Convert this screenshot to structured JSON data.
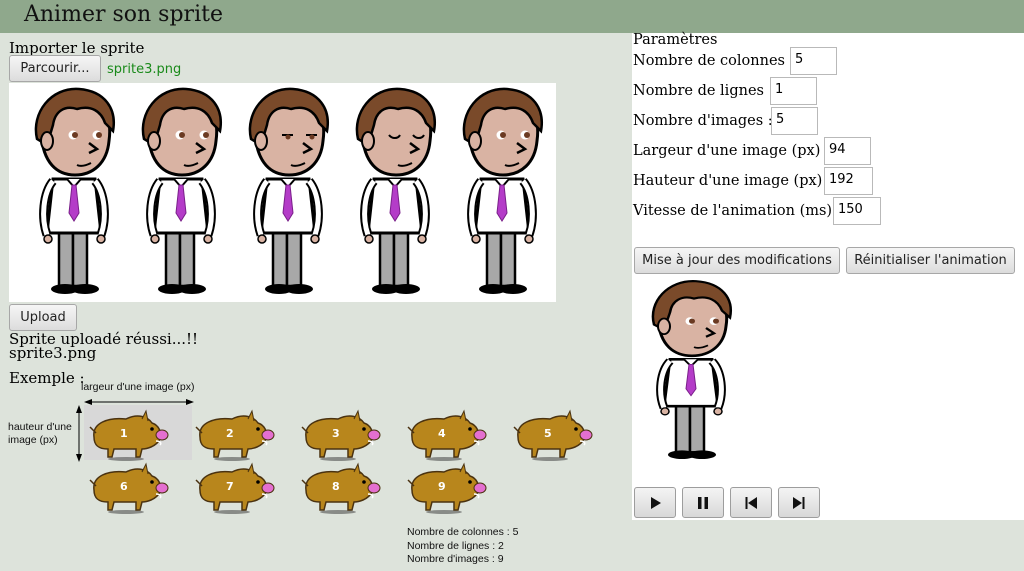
{
  "app": {
    "title": "Animer son sprite"
  },
  "import": {
    "heading": "Importer le sprite",
    "browse_label": "Parcourir...",
    "file_name": "sprite3.png",
    "upload_label": "Upload",
    "status_message": "Sprite uploadé réussi...!!",
    "uploaded_file": "sprite3.png"
  },
  "example": {
    "heading": "Exemple :",
    "width_label": "largeur d'une image (px)",
    "height_label_line1": "hauteur d'une",
    "height_label_line2": "image (px)",
    "frames": [
      "1",
      "2",
      "3",
      "4",
      "5",
      "6",
      "7",
      "8",
      "9"
    ],
    "caption_columns": "Nombre de colonnes : 5",
    "caption_rows": "Nombre de lignes : 2",
    "caption_images": "Nombre d'images : 9"
  },
  "params": {
    "heading": "Paramètres",
    "fields": [
      {
        "label": "Nombre de colonnes :",
        "value": "5"
      },
      {
        "label": "Nombre de lignes :",
        "value": "1"
      },
      {
        "label": "Nombre d'images :",
        "value": "5"
      },
      {
        "label": "Largeur d'une image (px) :",
        "value": "94"
      },
      {
        "label": "Hauteur d'une image (px) :",
        "value": "192"
      },
      {
        "label": "Vitesse de l'animation (ms) :",
        "value": "150"
      }
    ],
    "update_label": "Mise à jour des modifications",
    "reset_label": "Réinitialiser l'animation"
  },
  "controls": {
    "icons": [
      "play-icon",
      "pause-icon",
      "previous-frame-icon",
      "next-frame-icon"
    ]
  },
  "colors": {
    "header_bg": "#8fa88c",
    "page_bg": "#dde3db",
    "file_name": "#1a8a1a",
    "tie": "#b43cc8",
    "hair": "#7a4a2a",
    "boar": "#b8861c"
  }
}
